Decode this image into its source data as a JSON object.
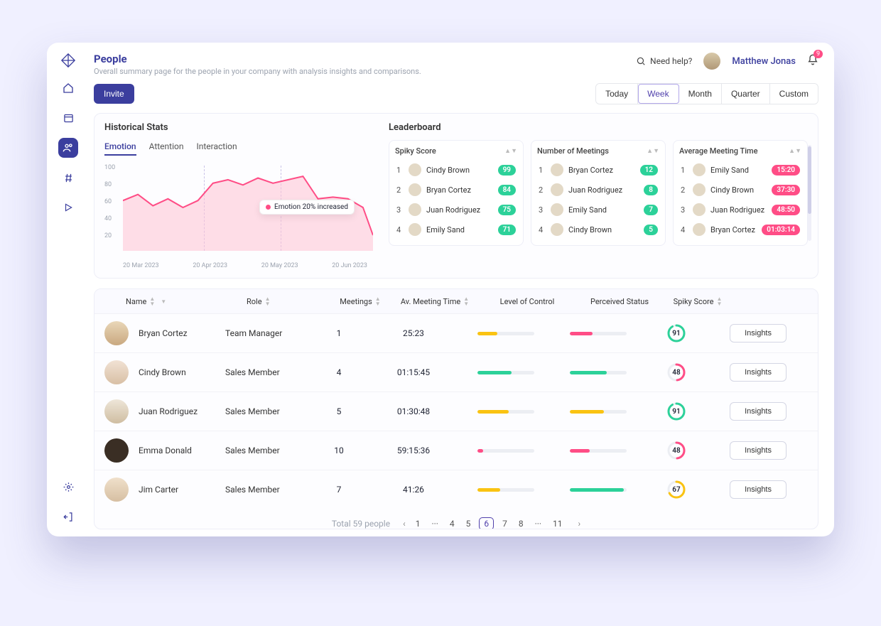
{
  "header": {
    "title": "People",
    "subtitle": "Overall summary page for the people in your company with analysis insights and comparisons.",
    "help": "Need help?",
    "user": "Matthew Jonas",
    "notif_count": "9",
    "invite": "Invite"
  },
  "timerange": {
    "items": [
      "Today",
      "Week",
      "Month",
      "Quarter",
      "Custom"
    ],
    "active": 1
  },
  "historical": {
    "title": "Historical Stats",
    "tabs": [
      "Emotion",
      "Attention",
      "Interaction"
    ],
    "active_tab": 0,
    "tooltip": "Emotion 20% increased",
    "y_ticks": [
      "100",
      "80",
      "60",
      "40",
      "20"
    ],
    "x_ticks": [
      "20 Mar 2023",
      "20 Apr 2023",
      "20 May 2023",
      "20 Jun 2023"
    ]
  },
  "leaderboard": {
    "title": "Leaderboard",
    "cols": [
      {
        "title": "Spiky Score",
        "pill": "green",
        "rows": [
          {
            "rank": "1",
            "name": "Cindy Brown",
            "val": "99"
          },
          {
            "rank": "2",
            "name": "Bryan Cortez",
            "val": "84"
          },
          {
            "rank": "3",
            "name": "Juan Rodriguez",
            "val": "75"
          },
          {
            "rank": "4",
            "name": "Emily Sand",
            "val": "71"
          }
        ]
      },
      {
        "title": "Number of Meetings",
        "pill": "green",
        "rows": [
          {
            "rank": "1",
            "name": "Bryan Cortez",
            "val": "12"
          },
          {
            "rank": "2",
            "name": "Juan Rodriguez",
            "val": "8"
          },
          {
            "rank": "3",
            "name": "Emily Sand",
            "val": "7"
          },
          {
            "rank": "4",
            "name": "Cindy Brown",
            "val": "5"
          }
        ]
      },
      {
        "title": "Average Meeting Time",
        "pill": "pink",
        "rows": [
          {
            "rank": "1",
            "name": "Emily Sand",
            "val": "15:20"
          },
          {
            "rank": "2",
            "name": "Cindy Brown",
            "val": "37:30"
          },
          {
            "rank": "3",
            "name": "Juan Rodriguez",
            "val": "48:50"
          },
          {
            "rank": "4",
            "name": "Bryan Cortez",
            "val": "01:03:14"
          }
        ]
      }
    ]
  },
  "table": {
    "headers": {
      "name": "Name",
      "role": "Role",
      "meetings": "Meetings",
      "avtime": "Av. Meeting Time",
      "loc": "Level of Control",
      "ps": "Perceived Status",
      "score": "Spiky Score"
    },
    "insights_label": "Insights",
    "rows": [
      {
        "name": "Bryan Cortez",
        "role": "Team Manager",
        "meetings": "1",
        "avtime": "25:23",
        "loc_pct": 35,
        "loc_color": "#fac312",
        "ps_pct": 40,
        "ps_color": "#ff4d86",
        "score": "91",
        "ring": "#2cd199",
        "avc": "av1"
      },
      {
        "name": "Cindy Brown",
        "role": "Sales Member",
        "meetings": "4",
        "avtime": "01:15:45",
        "loc_pct": 60,
        "loc_color": "#2cd199",
        "ps_pct": 65,
        "ps_color": "#2cd199",
        "score": "48",
        "ring": "#ff4d86",
        "avc": "av2"
      },
      {
        "name": "Juan Rodriguez",
        "role": "Sales Member",
        "meetings": "5",
        "avtime": "01:30:48",
        "loc_pct": 55,
        "loc_color": "#fac312",
        "ps_pct": 60,
        "ps_color": "#fac312",
        "score": "91",
        "ring": "#2cd199",
        "avc": "av3"
      },
      {
        "name": "Emma Donald",
        "role": "Sales Member",
        "meetings": "10",
        "avtime": "59:15:36",
        "loc_pct": 10,
        "loc_color": "#ff4d86",
        "ps_pct": 35,
        "ps_color": "#ff4d86",
        "score": "48",
        "ring": "#ff4d86",
        "avc": "av4"
      },
      {
        "name": "Jim Carter",
        "role": "Sales Member",
        "meetings": "7",
        "avtime": "41:26",
        "loc_pct": 40,
        "loc_color": "#fac312",
        "ps_pct": 95,
        "ps_color": "#2cd199",
        "score": "67",
        "ring": "#fac312",
        "avc": "av5"
      }
    ]
  },
  "pager": {
    "total": "Total 59 people",
    "pages": [
      "1",
      "···",
      "4",
      "5",
      "6",
      "7",
      "8",
      "···",
      "11"
    ],
    "active": "6"
  },
  "chart_data": {
    "type": "area",
    "title": "Historical Stats – Emotion",
    "x": [
      "20 Mar 2023",
      "20 Apr 2023",
      "20 May 2023",
      "20 Jun 2023"
    ],
    "y_range": [
      0,
      100
    ],
    "series": [
      {
        "name": "Emotion",
        "color": "#ff4d86",
        "points": [
          {
            "x_frac": 0.0,
            "y": 58
          },
          {
            "x_frac": 0.06,
            "y": 65
          },
          {
            "x_frac": 0.12,
            "y": 52
          },
          {
            "x_frac": 0.18,
            "y": 60
          },
          {
            "x_frac": 0.24,
            "y": 50
          },
          {
            "x_frac": 0.3,
            "y": 58
          },
          {
            "x_frac": 0.36,
            "y": 78
          },
          {
            "x_frac": 0.42,
            "y": 82
          },
          {
            "x_frac": 0.48,
            "y": 76
          },
          {
            "x_frac": 0.54,
            "y": 84
          },
          {
            "x_frac": 0.6,
            "y": 78
          },
          {
            "x_frac": 0.66,
            "y": 82
          },
          {
            "x_frac": 0.72,
            "y": 86
          },
          {
            "x_frac": 0.78,
            "y": 60
          },
          {
            "x_frac": 0.84,
            "y": 62
          },
          {
            "x_frac": 0.9,
            "y": 60
          },
          {
            "x_frac": 0.96,
            "y": 50
          },
          {
            "x_frac": 1.0,
            "y": 18
          }
        ]
      }
    ],
    "annotation": "Emotion 20% increased"
  }
}
